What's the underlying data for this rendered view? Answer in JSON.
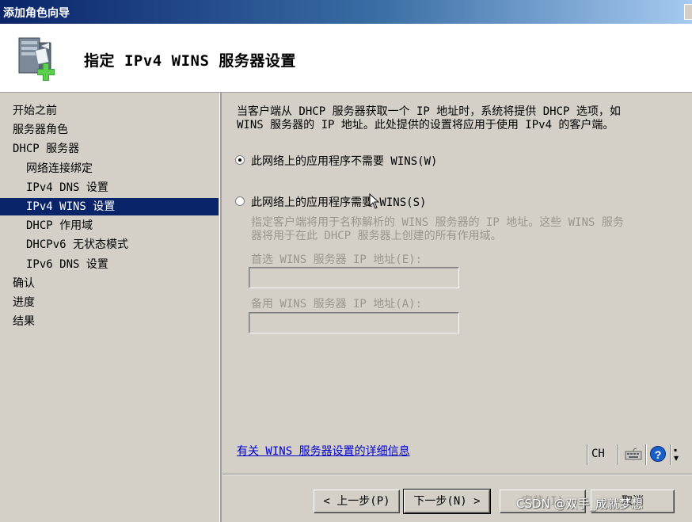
{
  "window": {
    "title": "添加角色向导"
  },
  "header": {
    "title": "指定 IPv4 WINS 服务器设置",
    "icon": "server-add-icon"
  },
  "nav": {
    "items": [
      {
        "label": "开始之前",
        "indent": 0,
        "selected": false
      },
      {
        "label": "服务器角色",
        "indent": 0,
        "selected": false
      },
      {
        "label": "DHCP 服务器",
        "indent": 0,
        "selected": false
      },
      {
        "label": "网络连接绑定",
        "indent": 1,
        "selected": false
      },
      {
        "label": "IPv4 DNS 设置",
        "indent": 1,
        "selected": false
      },
      {
        "label": "IPv4 WINS 设置",
        "indent": 1,
        "selected": true
      },
      {
        "label": "DHCP 作用域",
        "indent": 1,
        "selected": false
      },
      {
        "label": "DHCPv6 无状态模式",
        "indent": 1,
        "selected": false
      },
      {
        "label": "IPv6 DNS 设置",
        "indent": 1,
        "selected": false
      },
      {
        "label": "确认",
        "indent": 0,
        "selected": false
      },
      {
        "label": "进度",
        "indent": 0,
        "selected": false
      },
      {
        "label": "结果",
        "indent": 0,
        "selected": false
      }
    ]
  },
  "main": {
    "description_line1": "当客户端从 DHCP 服务器获取一个 IP 地址时，系统将提供 DHCP 选项，如",
    "description_line2": "WINS 服务器的 IP 地址。此处提供的设置将应用于使用 IPv4 的客户端。",
    "option_not_required": "此网络上的应用程序不需要 WINS(W)",
    "option_required": "此网络上的应用程序需要 WINS(S)",
    "selected_option": "not_required",
    "required_desc_line1": "指定客户端将用于名称解析的 WINS 服务器的 IP 地址。这些 WINS 服务",
    "required_desc_line2": "器将用于在此 DHCP 服务器上创建的所有作用域。",
    "preferred_label": "首选 WINS 服务器 IP 地址(E):",
    "preferred_value": "",
    "alternate_label": "备用 WINS 服务器 IP 地址(A):",
    "alternate_value": "",
    "info_link": "有关 WINS 服务器设置的详细信息"
  },
  "langbar": {
    "lang": "CH",
    "help": "?"
  },
  "buttons": {
    "back": "< 上一步(P)",
    "next": "下一步(N) >",
    "install": "安装(I)",
    "cancel": "取消"
  },
  "watermark": "CSDN @双手_成就梦想"
}
